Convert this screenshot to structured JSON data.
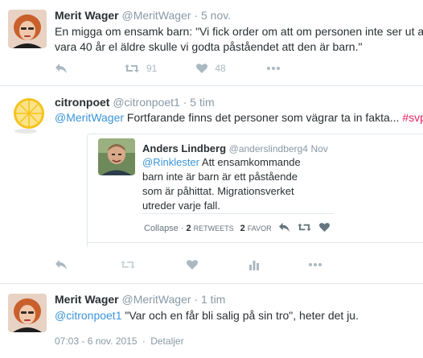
{
  "tweets": [
    {
      "name": "Merit Wager",
      "handle": "@MeritWager",
      "time": "5 nov.",
      "text_line1": "En migga om ensamk barn: \"Vi fick order om att om personen inte ser ut att",
      "text_line2": "vara 40 år el äldre skulle vi godta påståendet att den är barn.\"",
      "retweets": "91",
      "likes": "48"
    },
    {
      "name": "citronpoet",
      "handle": "@citronpoet1",
      "time": "5 tim",
      "mention": "@MeritWager",
      "text": " Fortfarande finns det personer som vägrar ta in fakta... ",
      "hashtag": "#svpol",
      "quote": {
        "name": "Anders Lindberg",
        "handle": "@anderslindberg4",
        "time": "Nov",
        "mention": "@Rinklester",
        "text": " Att ensamkommande barn inte är barn är ett påstående som är påhittat. Migrationsverket utreder varje fall.",
        "collapse": "Collapse",
        "retweets_count": "2",
        "retweets_label": "RETWEETS",
        "favorites_count": "2",
        "favorites_label": "FAVOR"
      }
    },
    {
      "name": "Merit Wager",
      "handle": "@MeritWager",
      "time": "1 tim",
      "mention": "@citronpoet1",
      "text": " \"Var och en får bli salig på sin tro\", heter det ju.",
      "timestamp": "07:03 - 6 nov. 2015",
      "details": "Detaljer"
    }
  ]
}
